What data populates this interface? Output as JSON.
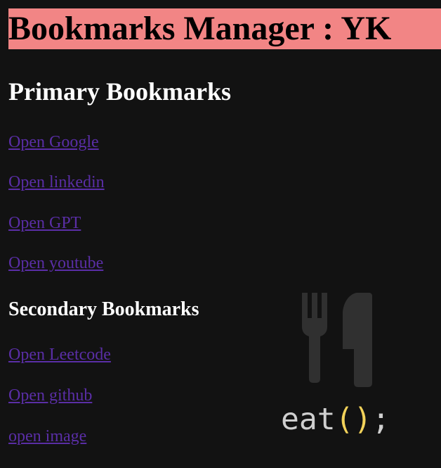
{
  "page": {
    "title": "Bookmarks Manager : YK"
  },
  "primary": {
    "heading": "Primary Bookmarks",
    "links": [
      {
        "label": "Open Google"
      },
      {
        "label": "Open linkedin"
      },
      {
        "label": "Open GPT"
      },
      {
        "label": "Open youtube"
      }
    ]
  },
  "secondary": {
    "heading": "Secondary Bookmarks",
    "links": [
      {
        "label": "Open Leetcode"
      },
      {
        "label": "Open github"
      },
      {
        "label": "open image"
      }
    ]
  },
  "logo": {
    "icon": "fork-knife-icon",
    "text_main": "eat",
    "text_open": "(",
    "text_close": ")",
    "text_end": ";"
  },
  "colors": {
    "background": "#121212",
    "title_bg": "#f28585",
    "link": "#5a2ea6",
    "logo_paren": "#f2d25a"
  }
}
